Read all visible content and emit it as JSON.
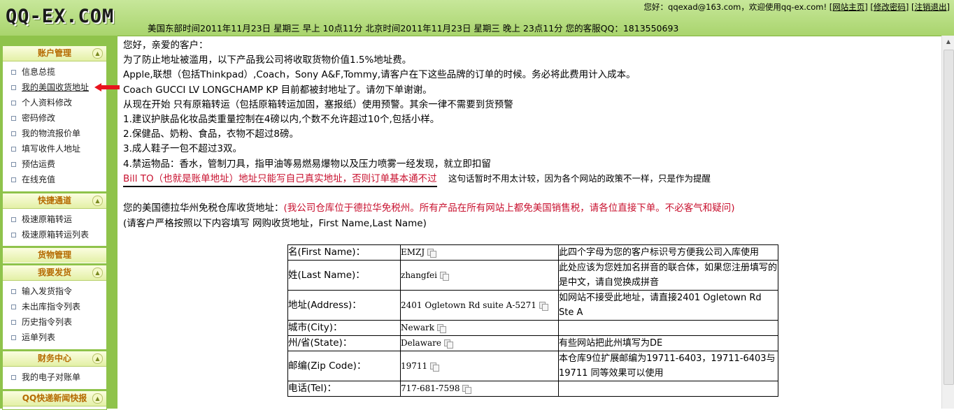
{
  "header": {
    "logo": "QQ-EX.COM",
    "user_greeting": "您好：qqexad@163.com，欢迎使用qq-ex.com!",
    "links": [
      "[网站主页]",
      "[修改密码]",
      "[注销退出]"
    ],
    "time_info": "美国东部时间2011年11月23日 星期三 早上 10点11分 北京时间2011年11月23日 星期三 晚上 23点11分 您的客服QQ：1813550693"
  },
  "sidebar": {
    "panels": [
      {
        "title": "账户管理",
        "items": [
          "信息总揽",
          "我的美国收货地址",
          "个人资料修改",
          "密码修改",
          "我的物流报价单",
          "填写收件人地址",
          "预估运费",
          "在线充值"
        ]
      },
      {
        "title": "快捷通道",
        "items": [
          "极速原箱转运",
          "极速原箱转运列表"
        ]
      },
      {
        "title": "货物管理",
        "items": []
      },
      {
        "title": "我要发货",
        "items": [
          "输入发货指令",
          "未出库指令列表",
          "历史指令列表",
          "运单列表"
        ]
      },
      {
        "title": "财务中心",
        "items": [
          "我的电子对账单"
        ]
      },
      {
        "title": "QQ快递新闻快报",
        "items": []
      }
    ]
  },
  "main": {
    "lines": [
      "您好，亲爱的客户：",
      "为了防止地址被滥用，以下产品我公司将收取货物价值1.5%地址费。",
      "Apple,联想（包括Thinkpad）,Coach，Sony A&F,Tommy,请客户在下这些品牌的订单的时候。务必将此费用计入成本。",
      "Coach GUCCI LV LONGCHAMP KP 目前都被封地址了。请勿下单谢谢。",
      "从现在开始 只有原箱转运（包括原箱转运加固，塞报纸）使用预警。其余一律不需要到货预警",
      "1.建议护肤品化妆品类重量控制在4磅以内,个数不允许超过10个,包括小样。",
      "2.保健品、奶粉、食品，衣物不超过8磅。",
      "3.成人鞋子一包不超过3双。",
      "4.禁运物品：香水，管制刀具，指甲油等易燃易爆物以及压力喷雾一经发现，就立即扣留"
    ],
    "billto_warning": "Bill TO（也就是账单地址）地址只能写自己真实地址，否则订单基本通不过",
    "billto_note": "这句话暂时不用太计较，因为各个网站的政策不一样，只是作为提醒",
    "store_label": "您的美国德拉华州免税仓库收货地址：",
    "store_note": "(我公司仓库位于德拉华免税州。所有产品在所有网站上都免美国销售税，请各位直接下单。不必客气和疑问)",
    "store_instruction": "(请客户严格按照以下内容填写 网购收货地址，First Name,Last Name)"
  },
  "address_table": [
    {
      "label": "名(First Name)：",
      "value": "EMZJ",
      "note": "此四个字母为您的客户标识号方便我公司入库使用"
    },
    {
      "label": "姓(Last Name)：",
      "value": "zhangfei",
      "note": "此处应该为您姓加名拼音的联合体，如果您注册填写的是中文，请自觉换成拼音"
    },
    {
      "label": "地址(Address)：",
      "value": "2401 Ogletown Rd suite A-5271",
      "note": "如网站不接受此地址，请直接2401 Ogletown Rd Ste A"
    },
    {
      "label": "城市(City)：",
      "value": "Newark",
      "note": ""
    },
    {
      "label": "州/省(State)：",
      "value": "Delaware",
      "note": "有些网站把此州填写为DE"
    },
    {
      "label": "邮编(Zip Code)：",
      "value": "19711",
      "note": "本仓库9位扩展邮编为19711-6403，19711-6403与19711 同等效果可以使用"
    },
    {
      "label": "电话(Tel)：",
      "value": "717-681-7598",
      "note": ""
    }
  ],
  "colors": {
    "header_green": "#a9d46d",
    "sidebar_green": "#8fc34b",
    "warning_red": "#c8102e",
    "panel_title": "#b56a00"
  }
}
